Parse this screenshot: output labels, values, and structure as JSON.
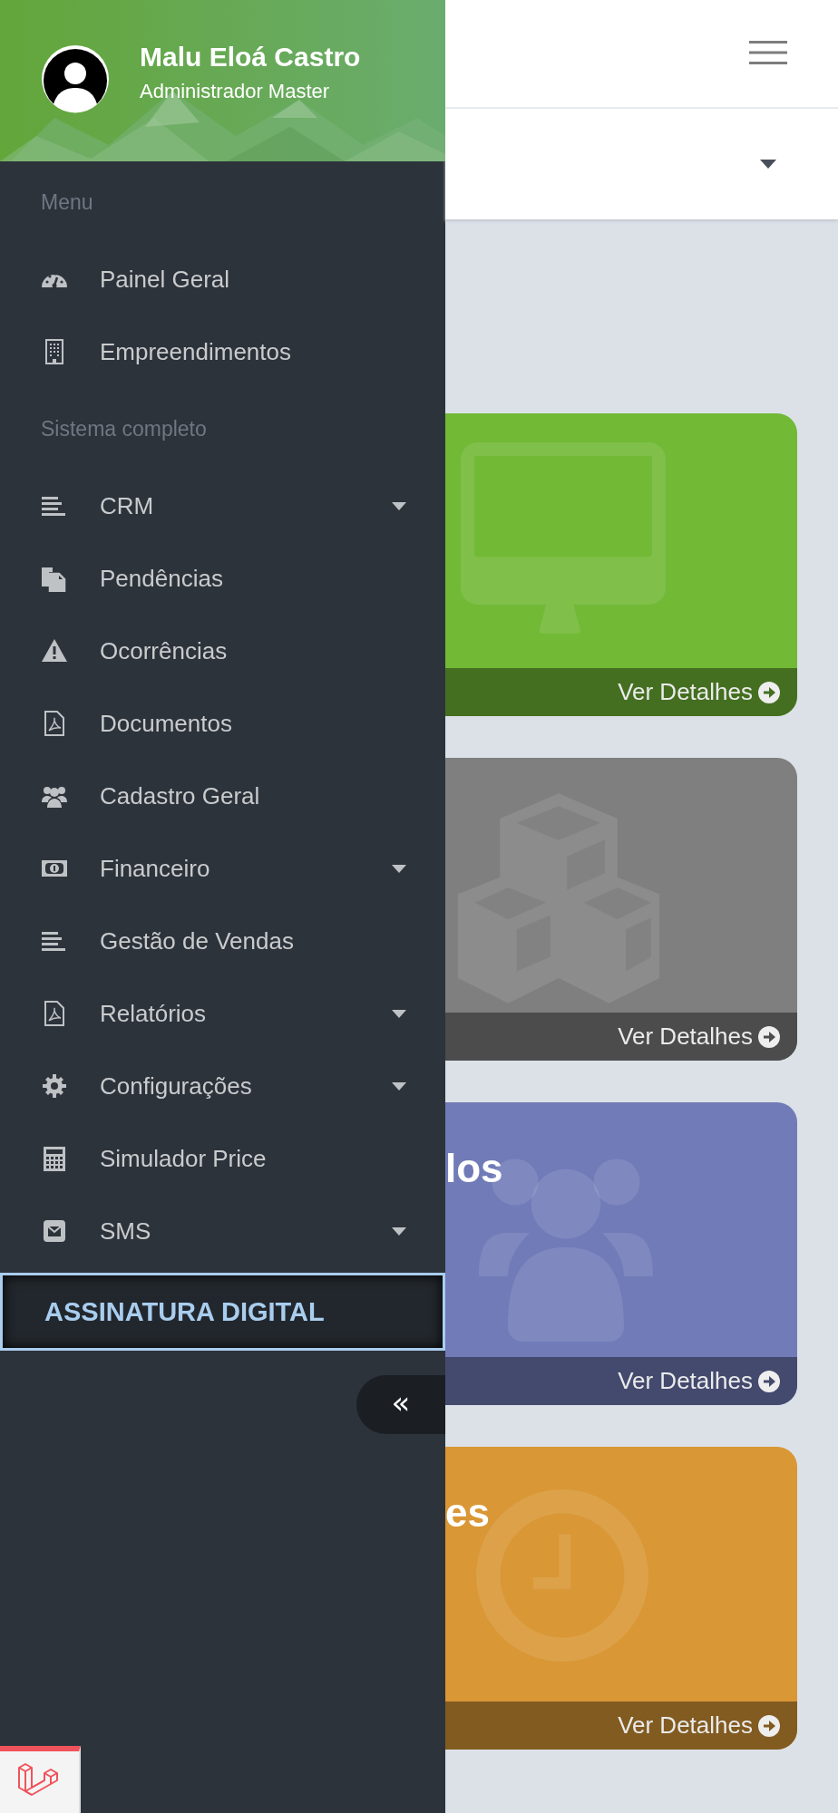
{
  "sidebar": {
    "profile": {
      "name": "Malu Eloá Castro",
      "role": "Administrador Master"
    },
    "items": [
      {
        "kind": "heading",
        "label": "Menu"
      },
      {
        "kind": "link",
        "label": "Painel Geral",
        "expandable": false,
        "selected": false
      },
      {
        "kind": "link",
        "label": "Empreendimentos",
        "expandable": false,
        "selected": false
      },
      {
        "kind": "heading",
        "label": "Sistema completo"
      },
      {
        "kind": "link",
        "label": "CRM",
        "expandable": true,
        "selected": false
      },
      {
        "kind": "link",
        "label": "Pendências",
        "expandable": false,
        "selected": false
      },
      {
        "kind": "link",
        "label": "Ocorrências",
        "expandable": false,
        "selected": false
      },
      {
        "kind": "link",
        "label": "Documentos",
        "expandable": false,
        "selected": false
      },
      {
        "kind": "link",
        "label": "Cadastro Geral",
        "expandable": false,
        "selected": false
      },
      {
        "kind": "link",
        "label": "Financeiro",
        "expandable": true,
        "selected": false
      },
      {
        "kind": "link",
        "label": "Gestão de Vendas",
        "expandable": false,
        "selected": false
      },
      {
        "kind": "link",
        "label": "Relatórios",
        "expandable": true,
        "selected": false
      },
      {
        "kind": "link",
        "label": "Configurações",
        "expandable": true,
        "selected": false
      },
      {
        "kind": "link",
        "label": "Simulador Price",
        "expandable": false,
        "selected": false
      },
      {
        "kind": "link",
        "label": "SMS",
        "expandable": true,
        "selected": false
      },
      {
        "kind": "link",
        "label": "ASSINATURA DIGITAL",
        "expandable": false,
        "selected": true
      }
    ],
    "collapse_button": {
      "label": "«"
    }
  },
  "cards": [
    {
      "color": "#72b936",
      "link": "Ver Detalhes"
    },
    {
      "color": "#7f7f7f",
      "link": "Ver Detalhes"
    },
    {
      "color": "#717bb8",
      "title": "los",
      "link": "Ver Detalhes"
    },
    {
      "color": "#d99735",
      "title": "es",
      "link": "Ver Detalhes"
    }
  ]
}
